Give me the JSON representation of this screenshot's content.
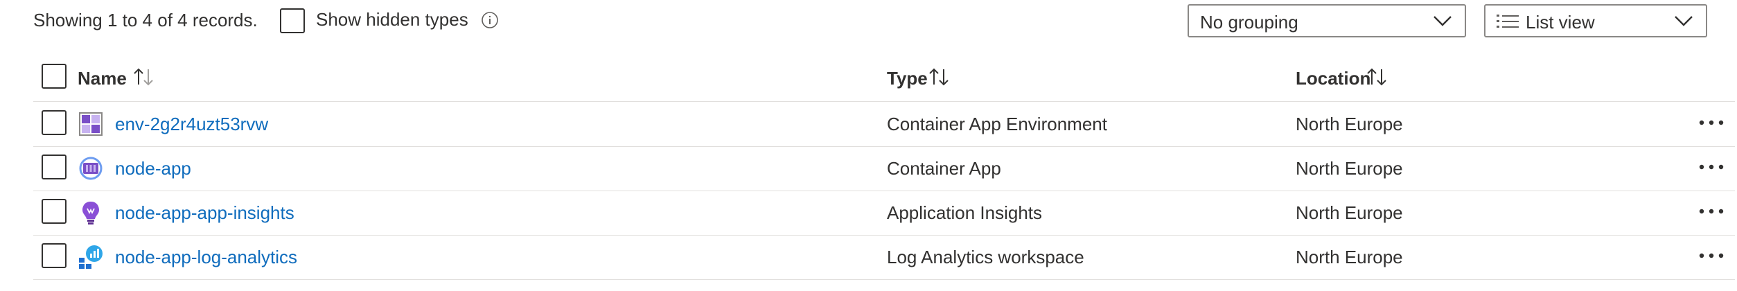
{
  "toolbar": {
    "records_text": "Showing 1 to 4 of 4 records.",
    "show_hidden_label": "Show hidden types",
    "show_hidden_checked": false,
    "grouping_value": "No grouping",
    "view_value": "List view"
  },
  "grid": {
    "columns": [
      {
        "label": "Name",
        "sort": "ascending"
      },
      {
        "label": "Type",
        "sort": "none"
      },
      {
        "label": "Location",
        "sort": "none"
      }
    ],
    "rows": [
      {
        "name": "env-2g2r4uzt53rvw",
        "type": "Container App Environment",
        "location": "North Europe",
        "icon": "container-app-environment-icon"
      },
      {
        "name": "node-app",
        "type": "Container App",
        "location": "North Europe",
        "icon": "container-app-icon"
      },
      {
        "name": "node-app-app-insights",
        "type": "Application Insights",
        "location": "North Europe",
        "icon": "application-insights-icon"
      },
      {
        "name": "node-app-log-analytics",
        "type": "Log Analytics workspace",
        "location": "North Europe",
        "icon": "log-analytics-icon"
      }
    ]
  },
  "colors": {
    "link": "#0f6cbd",
    "text": "#323130",
    "border": "#8a8886",
    "divider": "#e1dfdd"
  }
}
